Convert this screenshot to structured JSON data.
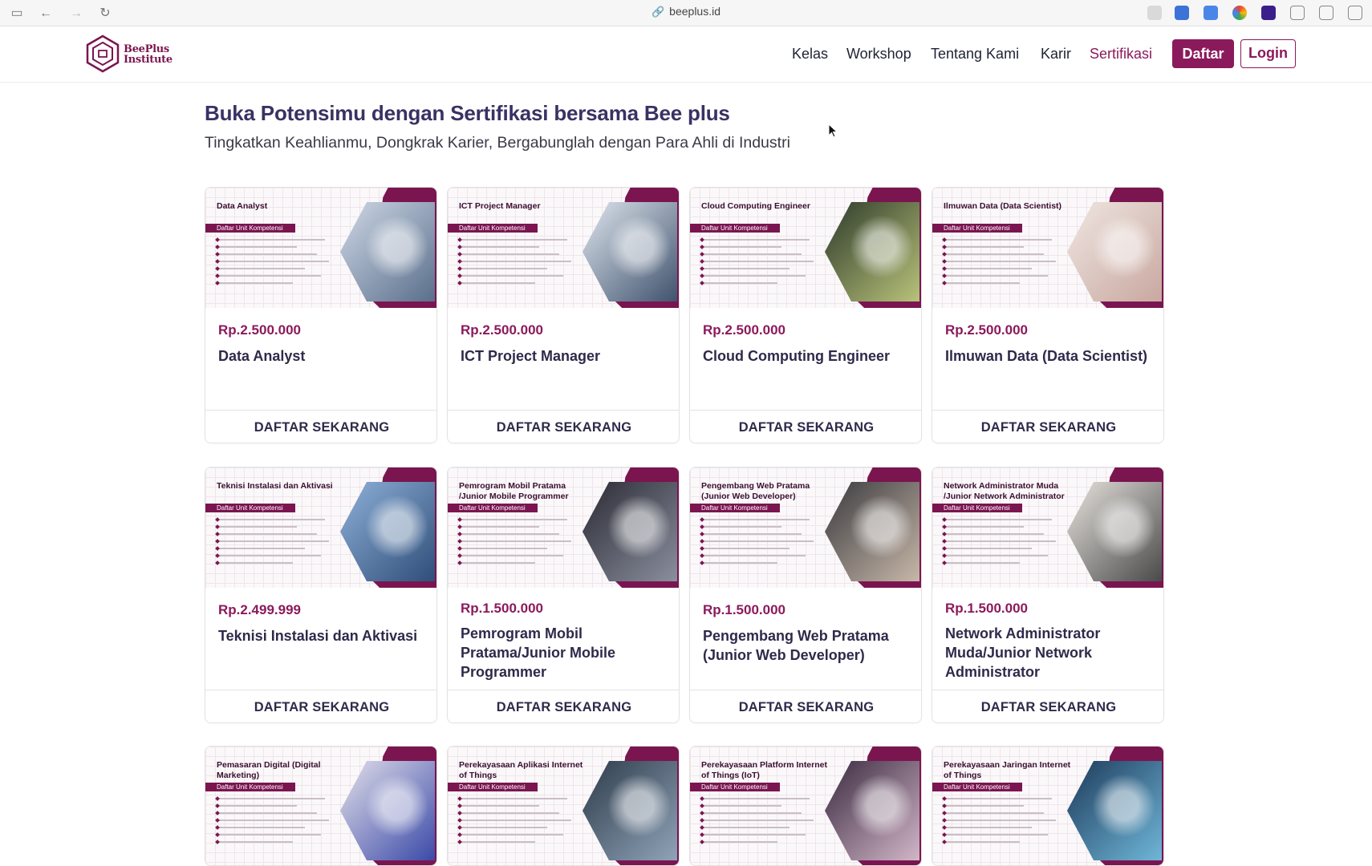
{
  "browser": {
    "url": "beeplus.id"
  },
  "brand": {
    "logo_text_line1": "BeePlus",
    "logo_text_line2": "Institute",
    "primary_color": "#8b1a5c",
    "heading_color": "#3a3163"
  },
  "nav": {
    "items": [
      "Kelas",
      "Workshop",
      "Tentang Kami",
      "Karir",
      "Sertifikasi"
    ],
    "active": "Sertifikasi",
    "daftar_label": "Daftar",
    "login_label": "Login"
  },
  "hero": {
    "title": "Buka Potensimu dengan Sertifikasi bersama Bee plus",
    "subtitle": "Tingkatkan Keahlianmu, Dongkrak Karier, Bergabunglah dengan Para Ahli di Industri"
  },
  "card_cta": "DAFTAR SEKARANG",
  "banner_ribbon": "Daftar Unit Kompetensi",
  "cards": [
    {
      "banner_title": "Data Analyst",
      "price": "Rp.2.500.000",
      "name": "Data Analyst",
      "image_icon": "laptop-dashboard-photo"
    },
    {
      "banner_title": "ICT Project Manager",
      "price": "Rp.2.500.000",
      "name": "ICT Project Manager",
      "image_icon": "laptop-charts-photo"
    },
    {
      "banner_title": "Cloud Computing Engineer",
      "price": "Rp.2.500.000",
      "name": "Cloud Computing Engineer",
      "image_icon": "network-switch-photo"
    },
    {
      "banner_title": "Ilmuwan Data (Data Scientist)",
      "price": "Rp.2.500.000",
      "name": "Ilmuwan Data (Data Scientist)",
      "image_icon": "phone-desk-photo"
    },
    {
      "banner_title": "Teknisi Instalasi dan Aktivasi",
      "price": "Rp.2.499.999",
      "name": "Teknisi Instalasi dan Aktivasi",
      "image_icon": "utility-pole-photo"
    },
    {
      "banner_title": "Pemrogram Mobil Pratama /Junior Mobile Programmer",
      "price": "Rp.1.500.000",
      "name": "Pemrogram Mobil Pratama/Junior Mobile Programmer",
      "image_icon": "code-laptop-photo"
    },
    {
      "banner_title": "Pengembang Web Pratama (Junior Web Developer)",
      "price": "Rp.1.500.000",
      "name": "Pengembang Web Pratama (Junior Web Developer)",
      "image_icon": "woman-laptop-photo"
    },
    {
      "banner_title": "Network Administrator Muda /Junior Network Administrator",
      "price": "Rp.1.500.000",
      "name": "Network Administrator Muda/Junior Network Administrator",
      "image_icon": "desk-laptop-photo"
    },
    {
      "banner_title": "Pemasaran Digital (Digital Marketing)",
      "price": "",
      "name": "",
      "image_icon": "typing-laptop-photo"
    },
    {
      "banner_title": "Perekayasaan Aplikasi Internet of Things",
      "price": "",
      "name": "",
      "image_icon": "server-room-photo"
    },
    {
      "banner_title": "Perekayasaan Platform Internet of Things (IoT)",
      "price": "",
      "name": "",
      "image_icon": "handshake-network-photo"
    },
    {
      "banner_title": "Perekayasaan Jaringan Internet of Things",
      "price": "",
      "name": "",
      "image_icon": "digital-touch-photo"
    }
  ]
}
